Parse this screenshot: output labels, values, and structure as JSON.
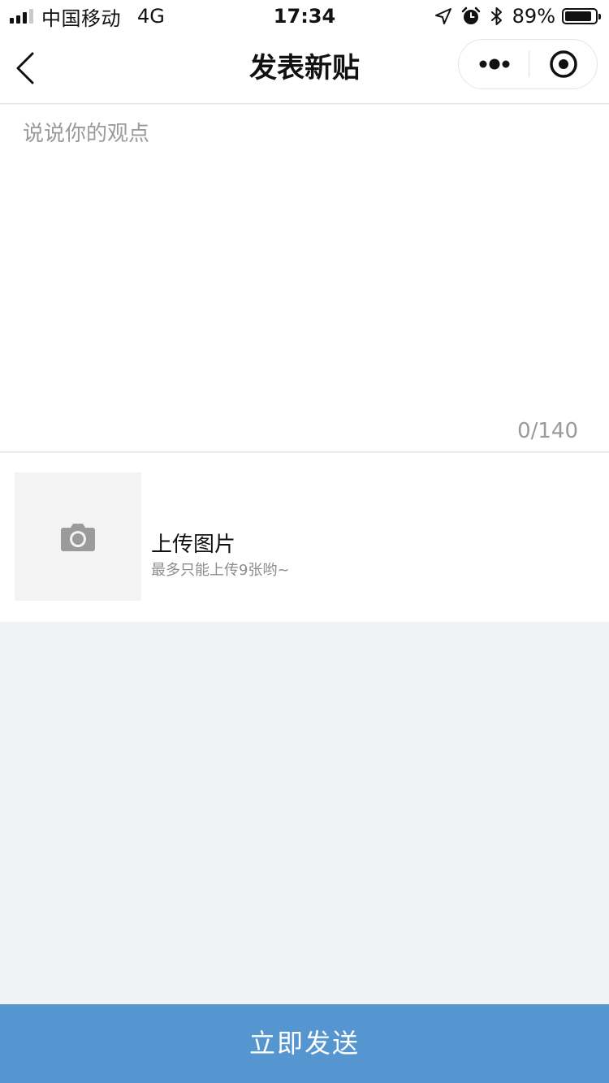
{
  "status_bar": {
    "carrier": "中国移动",
    "network": "4G",
    "time": "17:34",
    "battery_percent": "89%",
    "battery_level": 0.89,
    "icons": [
      "location-arrow-icon",
      "alarm-icon",
      "bluetooth-icon",
      "battery-icon"
    ]
  },
  "nav": {
    "title": "发表新贴",
    "back_icon": "chevron-left-icon",
    "more_icon": "more-dots-icon",
    "close_icon": "target-close-icon"
  },
  "editor": {
    "placeholder": "说说你的观点",
    "value": "",
    "counter": "0/140"
  },
  "upload": {
    "icon": "camera-icon",
    "title": "上传图片",
    "hint": "最多只能上传9张哟~"
  },
  "submit": {
    "label": "立即发送"
  },
  "colors": {
    "accent": "#5596d0",
    "page_background": "#f1f2f6",
    "placeholder": "#9a9a9a"
  }
}
